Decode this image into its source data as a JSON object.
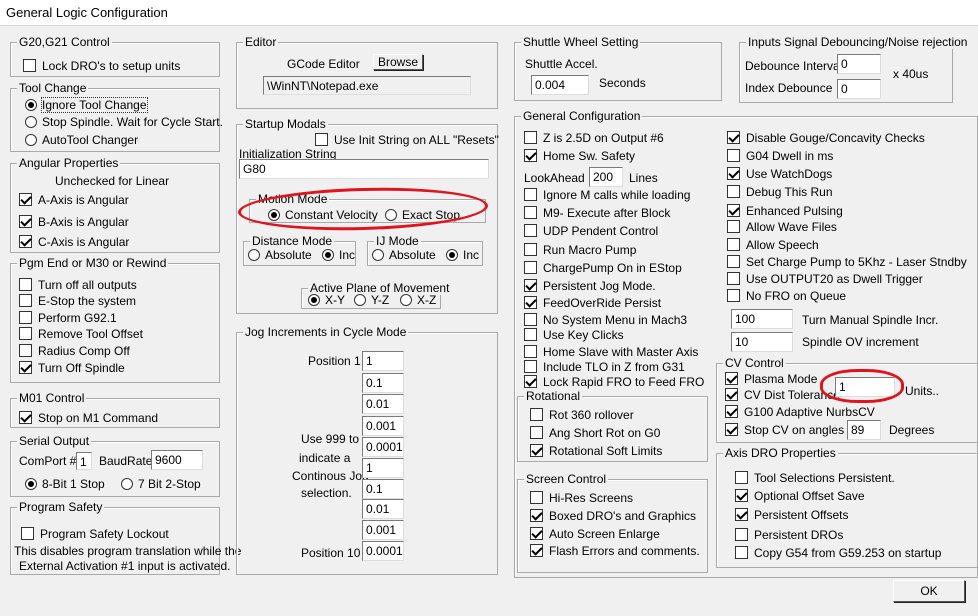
{
  "window": {
    "title": "General Logic Configuration"
  },
  "g20": {
    "title": "G20,G21 Control",
    "lock_dro": "Lock DRO's to setup units"
  },
  "tool_change": {
    "title": "Tool Change",
    "ignore": "Ignore Tool Change",
    "stop": "Stop Spindle. Wait for Cycle Start.",
    "auto": "AutoTool Changer"
  },
  "angular": {
    "title": "Angular Properties",
    "note": "Unchecked for Linear",
    "a": "A-Axis is Angular",
    "b": "B-Axis is Angular",
    "c": "C-Axis is Angular"
  },
  "pgm_end": {
    "title": "Pgm End or M30 or Rewind",
    "items": [
      "Turn off all outputs",
      "E-Stop the system",
      "Perform G92.1",
      "Remove Tool Offset",
      "Radius Comp Off",
      "Turn Off Spindle"
    ]
  },
  "m01": {
    "title": "M01 Control",
    "stop": "Stop on M1 Command"
  },
  "serial": {
    "title": "Serial Output",
    "comport_label": "ComPort #",
    "comport": "1",
    "baud_label": "BaudRate",
    "baud": "9600",
    "bit8": "8-Bit 1 Stop",
    "bit7": "7 Bit 2-Stop"
  },
  "safety": {
    "title": "Program Safety",
    "lockout": "Program Safety Lockout",
    "note1": "This disables program translation while the",
    "note2": "External Activation #1 input is activated."
  },
  "editor": {
    "title": "Editor",
    "label": "GCode Editor",
    "browse": "Browse",
    "path": "\\WinNT\\Notepad.exe"
  },
  "startup": {
    "title": "Startup Modals",
    "use_init": "Use Init String on ALL  \"Resets\"",
    "init_label": "Initialization String",
    "init": "G80",
    "motion_title": "Motion Mode",
    "constant": "Constant Velocity",
    "exact": "Exact Stop",
    "dist_title": "Distance Mode",
    "absolute": "Absolute",
    "inc": "Inc",
    "ij_title": "IJ Mode",
    "ij_absolute": "Absolute",
    "ij_inc": "Inc",
    "plane_title": "Active Plane of Movement",
    "xy": "X-Y",
    "yz": "Y-Z",
    "xz": "X-Z"
  },
  "jog": {
    "title": "Jog Increments in Cycle Mode",
    "pos1": "Position 1",
    "pos10": "Position 10",
    "note": [
      "Use 999 to",
      "indicate a",
      "Continous Jog",
      "selection."
    ],
    "values": [
      "1",
      "0.1",
      "0.01",
      "0.001",
      "0.0001",
      "1",
      "0.1",
      "0.01",
      "0.001",
      "0.0001"
    ]
  },
  "shuttle": {
    "title": "Shuttle Wheel Setting",
    "accel_label": "Shuttle Accel.",
    "accel": "0.004",
    "seconds": "Seconds"
  },
  "debounce": {
    "title": "Inputs Signal Debouncing/Noise rejection",
    "interval_label": "Debounce Interval",
    "interval": "0",
    "index_label": "Index Debounce",
    "index": "0",
    "units": "x 40us"
  },
  "general": {
    "title": "General Configuration",
    "left": [
      "Z is 2.5D on Output #6",
      "Home Sw. Safety",
      "",
      "Ignore M calls while loading",
      "M9- Execute after Block",
      "UDP Pendent Control",
      "Run Macro Pump",
      "ChargePump On in EStop",
      "Persistent Jog Mode.",
      "FeedOverRide Persist",
      "No System Menu in Mach3",
      "Use Key Clicks",
      "Home Slave with Master Axis",
      "Include TLO in Z from G31",
      "Lock Rapid FRO to Feed FRO"
    ],
    "lookahead_label": "LookAhead",
    "lookahead": "200",
    "lines": "Lines",
    "right": [
      "Disable Gouge/Concavity Checks",
      "G04 Dwell in ms",
      "Use WatchDogs",
      "Debug This Run",
      "Enhanced Pulsing",
      "Allow Wave Files",
      "Allow Speech",
      "Set Charge Pump to 5Khz  - Laser Stndby",
      "Use OUTPUT20 as Dwell Trigger",
      "No FRO on Queue"
    ],
    "spindle_incr": "100",
    "spindle_incr_label": "Turn Manual Spindle Incr.",
    "spindle_ov": "10",
    "spindle_ov_label": "Spindle OV increment"
  },
  "rotational": {
    "title": "Rotational",
    "items": [
      "Rot 360 rollover",
      "Ang Short Rot on G0",
      "Rotational Soft Limits"
    ]
  },
  "screen": {
    "title": "Screen Control",
    "items": [
      "Hi-Res Screens",
      "Boxed DRO's and Graphics",
      "Auto Screen Enlarge",
      "Flash Errors and comments."
    ]
  },
  "cv": {
    "title": "CV Control",
    "plasma": "Plasma Mode",
    "dist": "CV Dist Tolerance",
    "dist_val": "1",
    "units": "Units..",
    "g100": "G100 Adaptive NurbsCV",
    "stop_angles": "Stop CV on angles >",
    "angle": "89",
    "degrees": "Degrees"
  },
  "axis_dro": {
    "title": "Axis DRO Properties",
    "items": [
      "Tool Selections Persistent.",
      "Optional Offset Save",
      "Persistent Offsets",
      "Persistent DROs",
      "Copy G54 from G59.253 on startup"
    ]
  },
  "ok": "OK",
  "colors": {
    "annotation": "#e0141f",
    "background": "#f0f0f0"
  }
}
